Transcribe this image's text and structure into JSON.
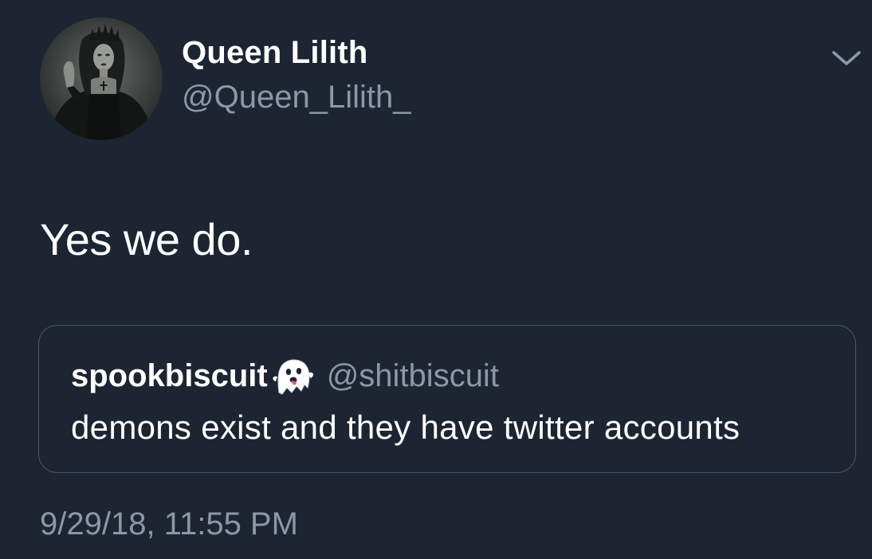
{
  "author": {
    "display_name": "Queen Lilith",
    "handle": "@Queen_Lilith_",
    "avatar_icon": "gothic-woman-avatar"
  },
  "menu": {
    "icon": "chevron-down-icon"
  },
  "tweet": {
    "text": "Yes we do.",
    "timestamp": "9/29/18, 11:55 PM"
  },
  "quoted_tweet": {
    "display_name": "spookbiscuit",
    "emoji_icon": "ghost-icon",
    "handle": "@shitbiscuit",
    "text": "demons exist and they have twitter accounts"
  },
  "colors": {
    "background": "#1d2532",
    "primary_text": "#ffffff",
    "secondary_text": "#8b98a5",
    "border": "#4a5666"
  }
}
